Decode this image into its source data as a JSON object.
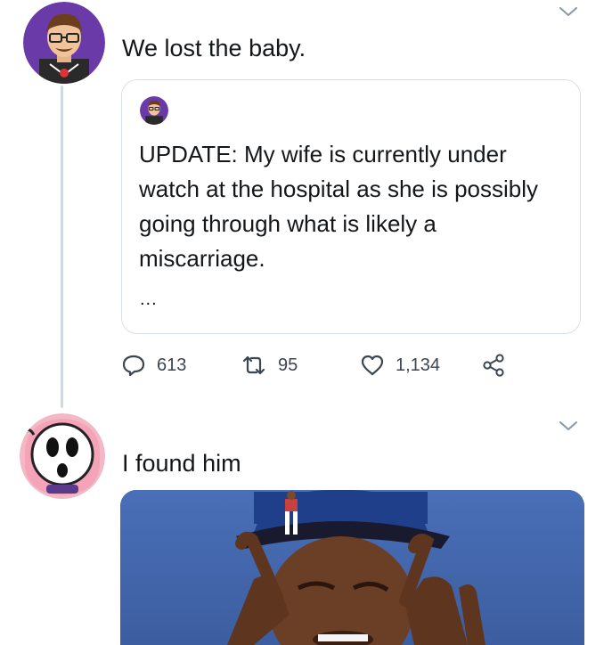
{
  "tweets": [
    {
      "text": "We lost the baby.",
      "quoted": {
        "text": "UPDATE: My wife is currently under watch at the hospital as she is possibly going through what is likely a miscarriage.",
        "ellipsis": "..."
      },
      "actions": {
        "replies": "613",
        "retweets": "95",
        "likes": "1,134"
      }
    },
    {
      "text": "I found him"
    }
  ],
  "icons": {
    "menu": "chevron-down-icon",
    "reply": "reply-icon",
    "retweet": "retweet-icon",
    "like": "heart-icon",
    "share": "share-icon"
  },
  "colors": {
    "text": "#14171a",
    "secondary": "#3c4650",
    "border": "#d9e0e5",
    "thread": "#cfd9de"
  }
}
